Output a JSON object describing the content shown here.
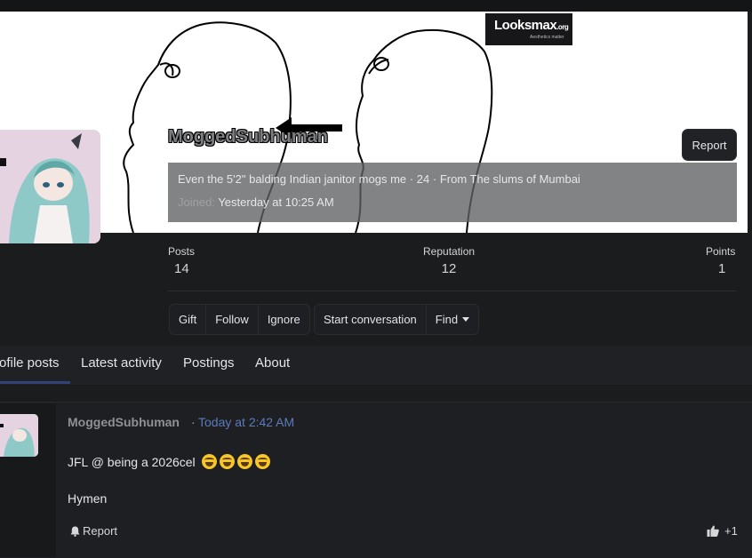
{
  "banner": {
    "logo_main": "Looksmax",
    "logo_domain": ".org",
    "logo_tagline": "Aesthetics matter"
  },
  "profile": {
    "username": "MoggedSubhuman",
    "report_label": "Report",
    "custom_title": "Even the 5'2\" balding Indian janitor mogs me",
    "age": "24",
    "location_prefix": "From",
    "location": "The slums of Mumbai",
    "separator": "·",
    "joined_label": "Joined:",
    "joined_value": "Yesterday at 10:25 AM"
  },
  "stats": [
    {
      "label": "Posts",
      "value": "14"
    },
    {
      "label": "Reputation",
      "value": "12"
    },
    {
      "label": "Points",
      "value": "1"
    }
  ],
  "actions": {
    "group1": [
      "Gift",
      "Follow",
      "Ignore"
    ],
    "group2": [
      "Start conversation",
      "Find"
    ]
  },
  "tabs": [
    "Profile posts",
    "Latest activity",
    "Postings",
    "About"
  ],
  "active_tab": "Profile posts",
  "post": {
    "author": "MoggedSubhuman",
    "separator": "·",
    "time": "Today at 2:42 AM",
    "text": "JFL @ being a 2026cel",
    "signature": "Hymen",
    "report_label": "Report",
    "reaction_score": "+1"
  },
  "colors": {
    "background": "#1b1c1e",
    "link": "#5b7bbb",
    "tab_underline": "#31427a"
  },
  "icons": [
    "bell-icon",
    "thumbs-up-icon",
    "chevron-down-icon",
    "arrow-left-icon"
  ]
}
